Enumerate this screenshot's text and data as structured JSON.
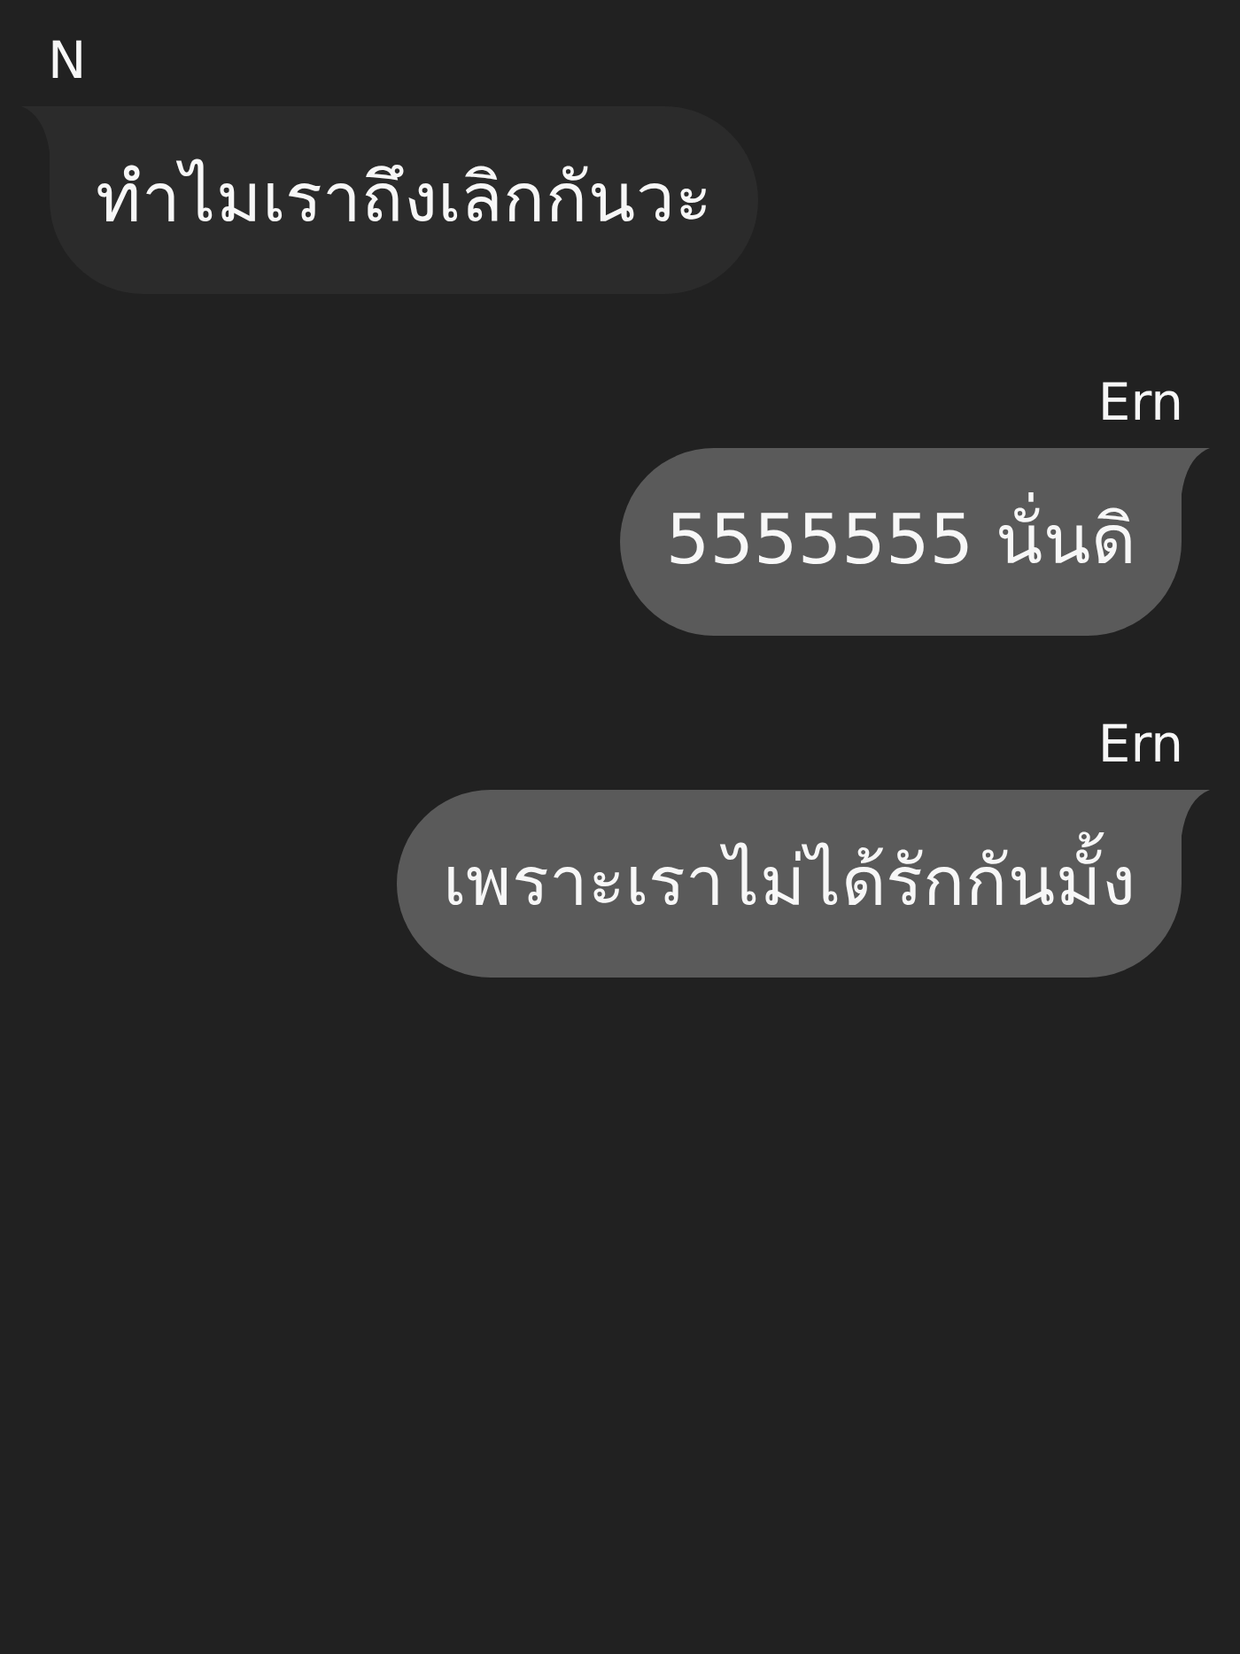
{
  "messages": [
    {
      "kind": "incoming",
      "sender": "N",
      "text": "ทำไมเราถึงเลิกกันวะ"
    },
    {
      "kind": "outgoing",
      "sender": "Ern",
      "text": "5555555 นั่นดิ"
    },
    {
      "kind": "outgoing",
      "sender": "Ern",
      "text": "เพราะเราไม่ได้รักกันมั้ง"
    }
  ]
}
